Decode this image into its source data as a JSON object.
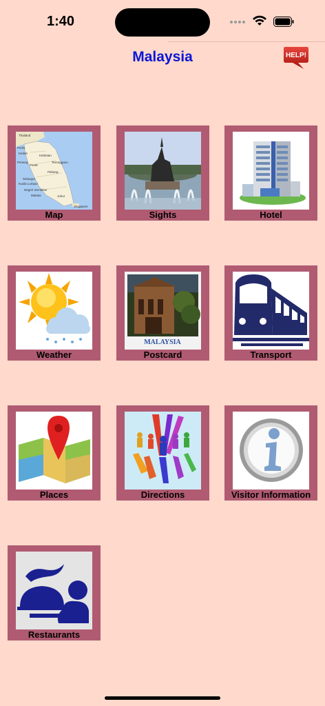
{
  "status": {
    "time": "1:40"
  },
  "header": {
    "title": "Malaysia",
    "help_label": "HELP!"
  },
  "tiles": [
    {
      "label": "Map",
      "icon": "map-icon"
    },
    {
      "label": "Sights",
      "icon": "sights-icon"
    },
    {
      "label": "Hotel",
      "icon": "hotel-icon"
    },
    {
      "label": "Weather",
      "icon": "weather-icon"
    },
    {
      "label": "Postcard",
      "icon": "postcard-icon"
    },
    {
      "label": "Transport",
      "icon": "transport-icon"
    },
    {
      "label": "Places",
      "icon": "places-icon"
    },
    {
      "label": "Directions",
      "icon": "directions-icon"
    },
    {
      "label": "Visitor Information",
      "icon": "info-icon"
    },
    {
      "label": "Restaurants",
      "icon": "restaurant-icon"
    }
  ],
  "map_labels": [
    "Thailand",
    "Perlis",
    "Kedah",
    "Penang",
    "Perak",
    "Kelantan",
    "Terengganu",
    "Pahang",
    "Selangor",
    "Kuala Lumpur",
    "Negeri Sembilan",
    "Melaka",
    "Johor",
    "Singapore"
  ],
  "postcard_caption": "MALAYSIA",
  "colors": {
    "background": "#FFD9CC",
    "tile_frame": "#B05B72",
    "title": "#0A16D6",
    "help_bubble": "#C8201E"
  }
}
